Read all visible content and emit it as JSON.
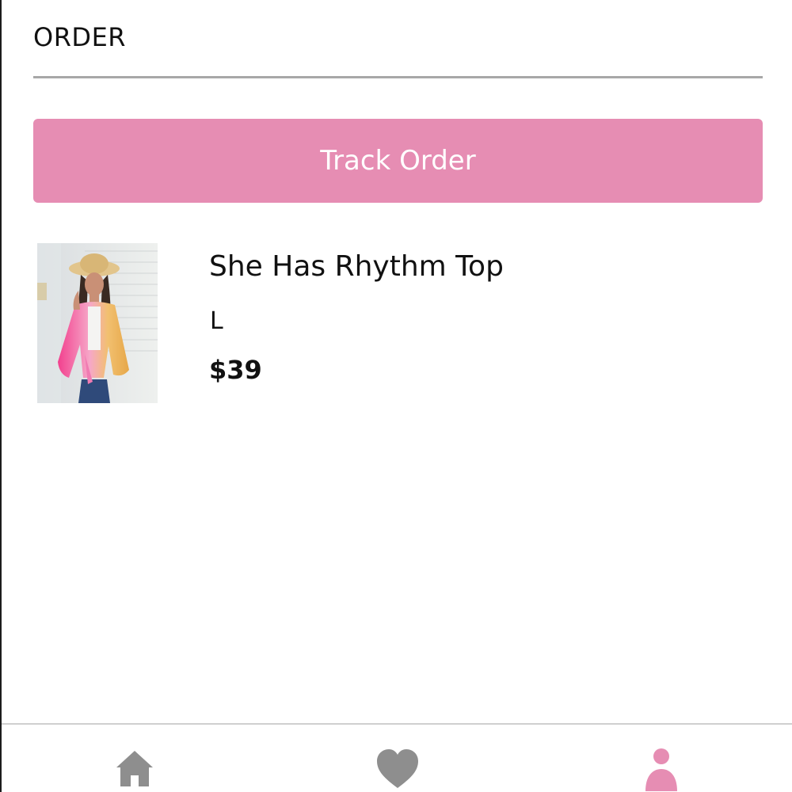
{
  "header": {
    "title": "ORDER"
  },
  "actions": {
    "track_order_label": "Track Order"
  },
  "order_item": {
    "name": "She Has Rhythm Top",
    "size": "L",
    "price": "$39"
  },
  "bottom_nav": {
    "items": [
      {
        "icon": "home-icon",
        "active": false
      },
      {
        "icon": "heart-icon",
        "active": false
      },
      {
        "icon": "user-icon",
        "active": true
      }
    ]
  },
  "colors": {
    "accent": "#e68db3",
    "nav_inactive": "#8e8e8e",
    "divider": "#a8a8a8"
  }
}
